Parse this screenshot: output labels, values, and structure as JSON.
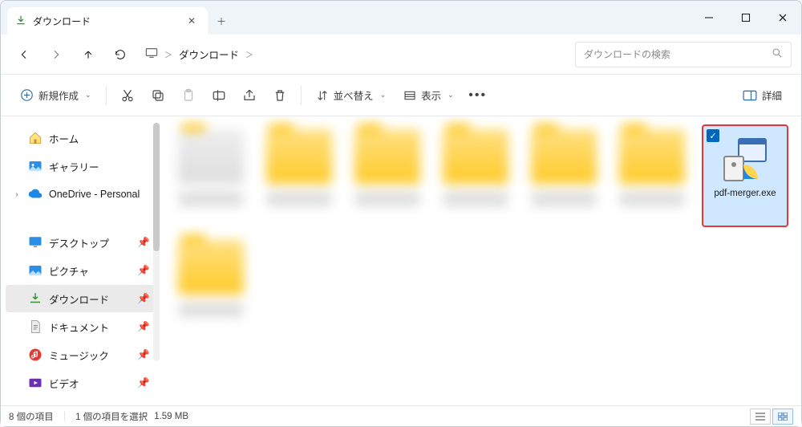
{
  "window": {
    "tab_title": "ダウンロード",
    "breadcrumb": [
      "ダウンロード"
    ],
    "search_placeholder": "ダウンロードの検索"
  },
  "toolbar": {
    "new": "新規作成",
    "sort": "並べ替え",
    "view": "表示",
    "details": "詳細"
  },
  "sidebar": {
    "home": "ホーム",
    "gallery": "ギャラリー",
    "onedrive": "OneDrive - Personal",
    "desktop": "デスクトップ",
    "pictures": "ピクチャ",
    "downloads": "ダウンロード",
    "documents": "ドキュメント",
    "music": "ミュージック",
    "videos": "ビデオ"
  },
  "selected_item": {
    "filename": "pdf-merger.exe"
  },
  "status": {
    "count": "8 個の項目",
    "selected": "1 個の項目を選択",
    "size": "1.59 MB"
  }
}
